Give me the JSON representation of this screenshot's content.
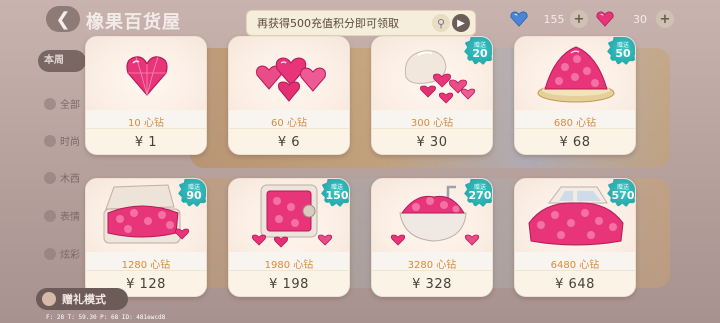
{
  "header": {
    "title": "橡果百货屋",
    "banner_text": "再获得500充值积分即可领取",
    "currency_blue": "155",
    "currency_pink": "30"
  },
  "sidebar": {
    "badge": "本周",
    "items": [
      "全部",
      "时尚",
      "木西",
      "表情",
      "炫彩"
    ]
  },
  "products": [
    {
      "name": "10 心钻",
      "price": "¥ 1",
      "bonus_label": "",
      "bonus": ""
    },
    {
      "name": "60 心钻",
      "price": "¥ 6",
      "bonus_label": "",
      "bonus": ""
    },
    {
      "name": "300 心钻",
      "price": "¥ 30",
      "bonus_label": "赠送",
      "bonus": "20"
    },
    {
      "name": "680 心钻",
      "price": "¥ 68",
      "bonus_label": "赠送",
      "bonus": "50"
    },
    {
      "name": "1280 心钻",
      "price": "¥ 128",
      "bonus_label": "赠送",
      "bonus": "90"
    },
    {
      "name": "1980 心钻",
      "price": "¥ 198",
      "bonus_label": "赠送",
      "bonus": "150"
    },
    {
      "name": "3280 心钻",
      "price": "¥ 328",
      "bonus_label": "赠送",
      "bonus": "270"
    },
    {
      "name": "6480 心钻",
      "price": "¥ 648",
      "bonus_label": "赠送",
      "bonus": "570"
    }
  ],
  "footer": {
    "gift_mode": "赠礼模式",
    "debug": "F: 28   T: 59.30   P: 68   ID: 481ewcd8"
  },
  "colors": {
    "accent_text": "#d88c3e",
    "badge_teal": "#26a8ab",
    "gem_pink": "#e8357a"
  }
}
